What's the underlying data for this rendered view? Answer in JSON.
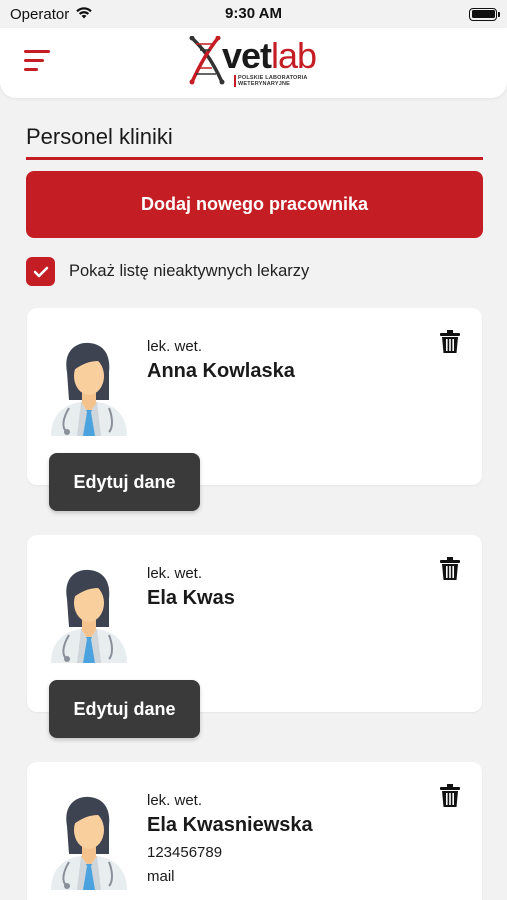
{
  "status_bar": {
    "carrier": "Operator",
    "time": "9:30 AM"
  },
  "header": {
    "logo_vet": "vet",
    "logo_lab": "lab",
    "logo_sub_line1": "POLSKIE LABORATORIA",
    "logo_sub_line2": "WETERYNARYJNE"
  },
  "page": {
    "title": "Personel kliniki",
    "add_button_label": "Dodaj nowego pracownika",
    "show_inactive_label": "Pokaż listę nieaktywnych lekarzy",
    "show_inactive_checked": true
  },
  "staff": [
    {
      "title": "lek. wet.",
      "name": "Anna Kowlaska",
      "edit_label": "Edytuj dane"
    },
    {
      "title": "lek. wet.",
      "name": "Ela Kwas",
      "edit_label": "Edytuj dane"
    },
    {
      "title": "lek. wet.",
      "name": "Ela Kwasniewska",
      "phone": "123456789",
      "mail": "mail"
    }
  ],
  "colors": {
    "accent": "#c41e24",
    "edit_button": "#3a3a3a",
    "background": "#f2f2f2"
  }
}
